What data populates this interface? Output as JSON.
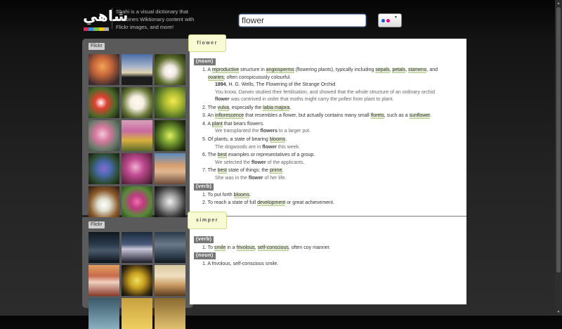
{
  "header": {
    "logo_text": "شاهي",
    "logo_colors": [
      "#e0245e",
      "#3a8fd6",
      "#7bc043",
      "#f5c400",
      "#aaaaaa"
    ],
    "tagline": "Shahi is a visual dictionary that combines Wiktionary content with Flickr images, and more!",
    "search_value": "flower",
    "source_icon": "flickr-icon",
    "dropdown_icon": "chevron-down-icon"
  },
  "colors": {
    "accent_tab": "#f7fad2",
    "link_highlight": "#e4edd4",
    "pos_badge": "#777777"
  },
  "panel1": {
    "label": "Flickr",
    "images": [
      "orange-flower-photo",
      "dusk-landscape-photo",
      "white-flower-photo",
      "red-white-flowers-photo",
      "white-daisies-photo",
      "yellow-flower-photo",
      "pink-lily-photo",
      "flower-field-photo",
      "green-flower-photo",
      "purple-flowers-photo",
      "pink-blossoms-photo",
      "flower-crown-people-photo",
      "dandelion-photo",
      "clover-flower-photo",
      "bw-flower-photo"
    ]
  },
  "panel2": {
    "label": "Flickr",
    "images": [
      "band-on-stage-photo",
      "concert-photo",
      "band-photo",
      "performer-photo",
      "stage-light-photo",
      "singer-photo",
      "crowd-photo",
      "stage-photo",
      "performer-2-photo"
    ]
  },
  "sections": [
    {
      "word": "flower",
      "noun_label": "(noun)",
      "noun": {
        "d1": [
          "1. A ",
          "reproductive",
          " structure in ",
          "angiosperms",
          " (flowering plants), typically including ",
          "sepals",
          ", ",
          "petals",
          ", ",
          "stamens",
          ", and"
        ],
        "d1b": [
          "ovaries",
          "; often conspicuously colourful."
        ],
        "q1": [
          "1894",
          ", H. G. Wells, The Flowering of the Strange Orchid"
        ],
        "q1b": "You know, Darwin studied their fertilisation, and showed that the whole structure of an ordinary orchid",
        "q1c": [
          "flower",
          " was contrived in order that moths might carry the pollen from plant to plant."
        ],
        "d2": [
          "2. The ",
          "vulva",
          ", especially the ",
          "labia majora",
          "."
        ],
        "d3": [
          "3. An ",
          "inflorescence",
          " that resembles a flower, but actually contains many small ",
          "florets",
          ", such as a ",
          "sunflower",
          "."
        ],
        "d4": [
          "4. A ",
          "plant",
          " that bears flowers."
        ],
        "q4": [
          "We transplanted the ",
          "flowers",
          " to a larger pot."
        ],
        "d5": [
          "5. Of plants, a state of bearing ",
          "blooms",
          "."
        ],
        "q5": [
          "The dogwoods are in ",
          "flower",
          " this week."
        ],
        "d6": [
          "6. The ",
          "best",
          " examples or representatives of a group."
        ],
        "q6": [
          "We selected the ",
          "flower",
          " of the applicants."
        ],
        "d7": [
          "7. The ",
          "best",
          " state of things; the ",
          "prime",
          "."
        ],
        "q7": [
          "She was in the ",
          "flower",
          " of her life."
        ]
      },
      "verb_label": "(verb)",
      "verb": {
        "d1": [
          "1. To put forth ",
          "blooms",
          "."
        ],
        "d2": [
          "2. To reach a state of full ",
          "development",
          " or great achievement."
        ]
      }
    },
    {
      "word": "simper",
      "verb_label": "(verb)",
      "verb": {
        "d1": [
          "1. To ",
          "smile",
          " in a ",
          "frivolous",
          ", ",
          "self-conscious",
          ", often coy manner."
        ]
      },
      "noun_label": "(noun)",
      "noun": {
        "d1": [
          "1. A frivolous, self-conscious smile."
        ]
      }
    }
  ],
  "scrollbar": {
    "up_icon": "scroll-up-icon",
    "down_icon": "scroll-down-icon"
  }
}
